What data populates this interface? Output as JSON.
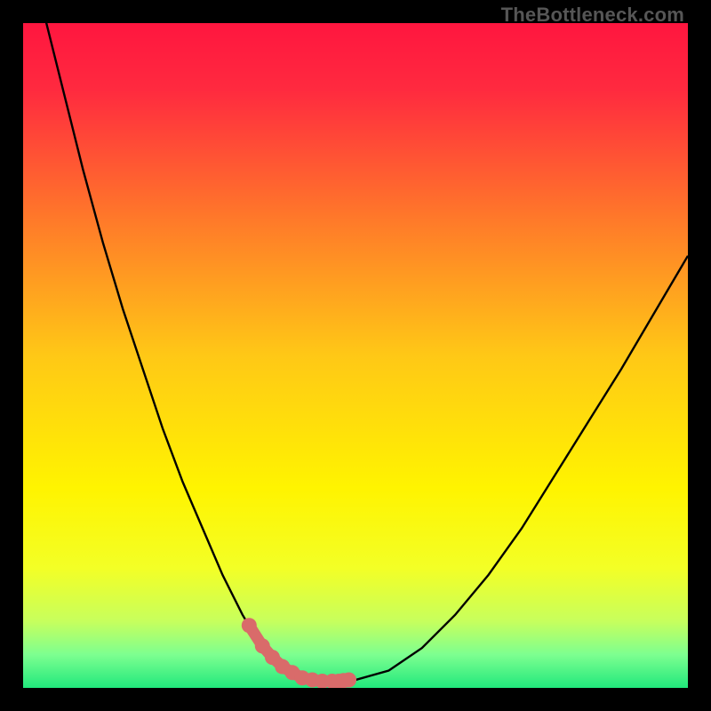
{
  "watermark": "TheBottleneck.com",
  "colors": {
    "gradient_stops": [
      {
        "offset": 0.0,
        "color": "#ff163f"
      },
      {
        "offset": 0.1,
        "color": "#ff2a3f"
      },
      {
        "offset": 0.3,
        "color": "#ff7b29"
      },
      {
        "offset": 0.5,
        "color": "#ffc816"
      },
      {
        "offset": 0.7,
        "color": "#fff400"
      },
      {
        "offset": 0.82,
        "color": "#f3ff26"
      },
      {
        "offset": 0.9,
        "color": "#c7ff5d"
      },
      {
        "offset": 0.95,
        "color": "#7dff90"
      },
      {
        "offset": 1.0,
        "color": "#21e87c"
      }
    ],
    "curve": "#000000",
    "highlight_fill": "#d96b6a",
    "highlight_stroke": "#cf5e5e"
  },
  "chart_data": {
    "type": "line",
    "title": "",
    "xlabel": "",
    "ylabel": "",
    "xlim": [
      0,
      100
    ],
    "ylim": [
      0,
      100
    ],
    "categories_x": [
      0,
      3,
      6,
      9,
      12,
      15,
      18,
      21,
      24,
      27,
      30,
      33,
      34.5,
      36,
      37.5,
      39,
      40.5,
      42,
      43.5,
      45,
      46.5,
      48,
      50,
      55,
      60,
      65,
      70,
      75,
      80,
      85,
      90,
      95,
      100
    ],
    "values_y": [
      115,
      102,
      90,
      78,
      67,
      57,
      48,
      39,
      31,
      24,
      17,
      11,
      8.5,
      6.3,
      4.6,
      3.2,
      2.3,
      1.5,
      1.2,
      1.0,
      1.0,
      1.0,
      1.2,
      2.6,
      6.0,
      11.0,
      17.0,
      24.0,
      32.0,
      40.0,
      48.0,
      56.5,
      65.0
    ],
    "highlight_segment": {
      "x_start": 34.0,
      "x_end": 49.0,
      "points": [
        {
          "x": 34.0,
          "y": 9.4
        },
        {
          "x": 36.0,
          "y": 6.3
        },
        {
          "x": 37.5,
          "y": 4.6
        },
        {
          "x": 39.0,
          "y": 3.2
        },
        {
          "x": 40.5,
          "y": 2.3
        },
        {
          "x": 42.0,
          "y": 1.5
        },
        {
          "x": 43.5,
          "y": 1.2
        },
        {
          "x": 45.0,
          "y": 1.0
        },
        {
          "x": 46.5,
          "y": 1.0
        },
        {
          "x": 47.5,
          "y": 1.0
        },
        {
          "x": 48.2,
          "y": 1.1
        },
        {
          "x": 49.0,
          "y": 1.2
        }
      ]
    },
    "legend": [],
    "grid": false
  }
}
